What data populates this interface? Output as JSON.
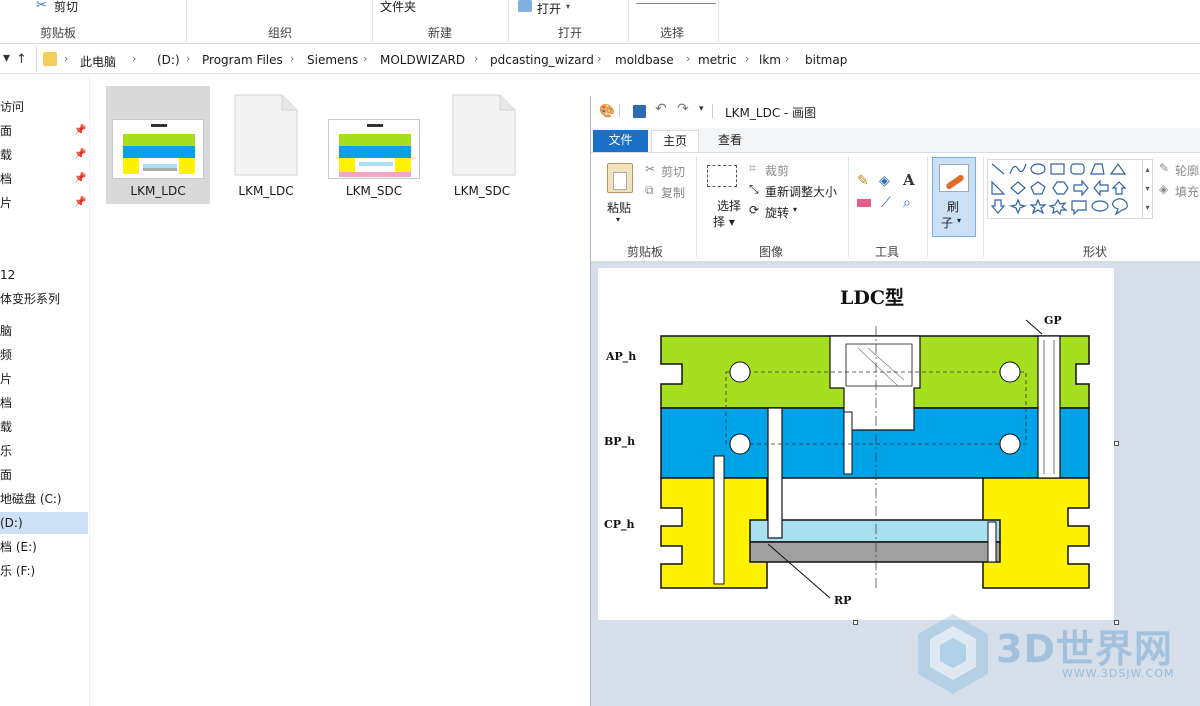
{
  "explorer": {
    "ribbon": {
      "cut": "剪切",
      "clipboard_group": "剪贴板",
      "organize_group": "组织",
      "new_folder": "文件夹",
      "new_group": "新建",
      "open_btn": "打开",
      "open_group": "打开",
      "select_group": "选择"
    },
    "breadcrumb": [
      "此电脑",
      "(D:)",
      "Program Files",
      "Siemens",
      "MOLDWIZARD",
      "pdcasting_wizard",
      "moldbase",
      "metric",
      "lkm",
      "bitmap"
    ],
    "sidebar": [
      "访问",
      "面",
      "载",
      "档",
      "片",
      "12",
      "体变形系列",
      "脑",
      "频",
      "片",
      "档",
      "载",
      "乐",
      "面",
      "地磁盘 (C:)",
      "(D:)",
      "档 (E:)",
      "乐 (F:)"
    ],
    "files": [
      {
        "name": "LKM_LDC",
        "kind": "image",
        "selected": true
      },
      {
        "name": "LKM_LDC",
        "kind": "document",
        "selected": false
      },
      {
        "name": "LKM_SDC",
        "kind": "image",
        "selected": false
      },
      {
        "name": "LKM_SDC",
        "kind": "document",
        "selected": false
      }
    ]
  },
  "paint": {
    "title": "LKM_LDC - 画图",
    "tabs": {
      "file": "文件",
      "home": "主页",
      "view": "查看"
    },
    "ribbon": {
      "paste": "粘贴",
      "cut": "剪切",
      "copy": "复制",
      "clipboard_group": "剪贴板",
      "select": "选择",
      "crop": "裁剪",
      "resize": "重新调整大小",
      "rotate": "旋转",
      "image_group": "图像",
      "tools_group": "工具",
      "brushes_top": "刷",
      "brushes_bottom": "子",
      "outline": "轮廓",
      "fill": "填充",
      "shapes_group": "形状"
    },
    "drawing": {
      "title": "LDC型",
      "labels": {
        "ap": "AP_h",
        "bp": "BP_h",
        "cp": "CP_h",
        "gp": "GP",
        "rp": "RP"
      }
    }
  },
  "watermark": {
    "brand": "3D世界网",
    "url": "WWW.3DSJW.COM"
  },
  "colors": {
    "plate_green": "#a5df1f",
    "plate_blue": "#00a3e8",
    "plate_yellow": "#fff200",
    "paint_blue": "#1a6fc8"
  }
}
